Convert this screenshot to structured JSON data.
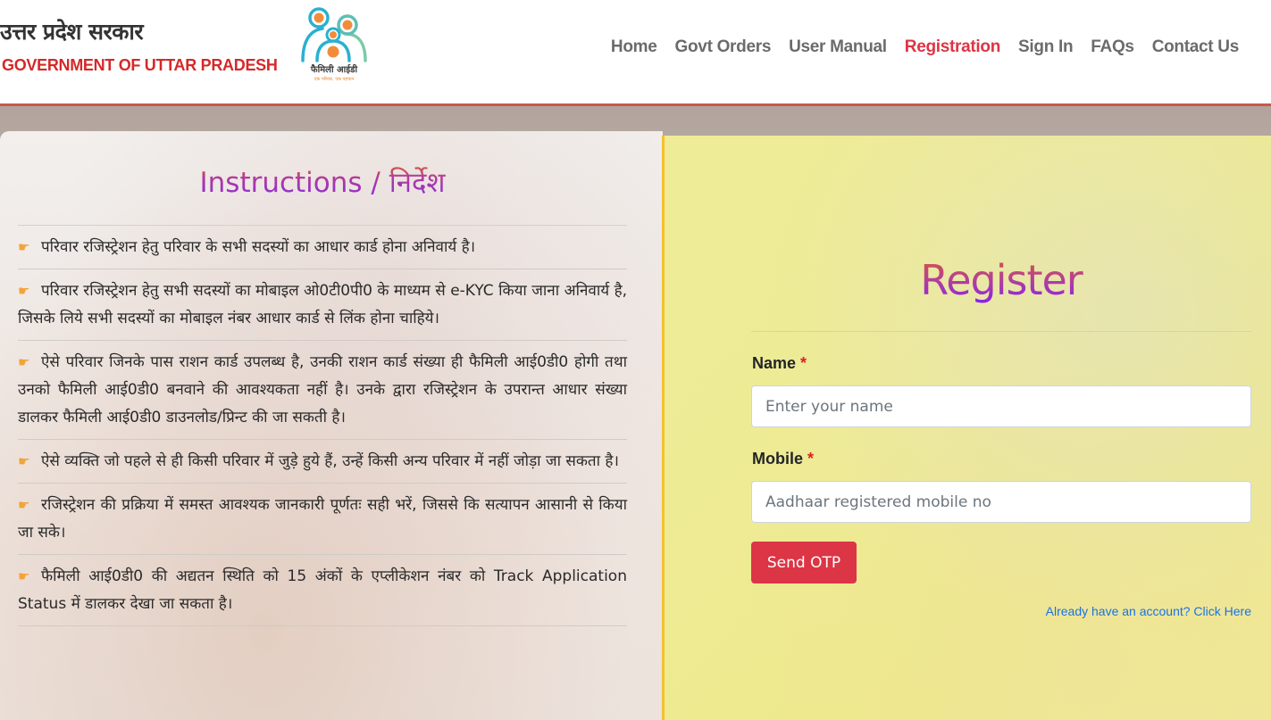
{
  "header": {
    "brand_hindi": "उत्तर प्रदेश सरकार",
    "brand_english": "GOVERNMENT OF UTTAR PRADESH",
    "logo_text": "फैमिली आईडी",
    "logo_tagline": "एक परिवार, एक पहचान",
    "nav": [
      {
        "label": "Home",
        "active": false
      },
      {
        "label": "Govt Orders",
        "active": false
      },
      {
        "label": "User Manual",
        "active": false
      },
      {
        "label": "Registration",
        "active": true
      },
      {
        "label": "Sign In",
        "active": false
      },
      {
        "label": "FAQs",
        "active": false
      },
      {
        "label": "Contact Us",
        "active": false
      }
    ]
  },
  "instructions": {
    "title": "Instructions / निर्देश",
    "bullet_icon": "hand-pointing-right-icon",
    "items": [
      "परिवार रजिस्ट्रेशन हेतु परिवार के सभी सदस्यों का आधार कार्ड होना अनिवार्य है।",
      "परिवार रजिस्ट्रेशन हेतु सभी सदस्यों का मोबाइल ओ0टी0पी0 के माध्यम से e-KYC किया जाना अनिवार्य है, जिसके लिये सभी सदस्यों का मोबाइल नंबर आधार कार्ड से लिंक होना चाहिये।",
      "ऐसे परिवार जिनके पास राशन कार्ड उपलब्ध है, उनकी राशन कार्ड संख्या ही फैमिली आई0डी0 होगी तथा उनको फैमिली आई0डी0 बनवाने की आवश्यकता नहीं है। उनके द्वारा रजिस्ट्रेशन के उपरान्त आधार संख्या डालकर फैमिली आई0डी0 डाउनलोड/प्रिन्ट की जा सकती है।",
      "ऐसे व्यक्ति जो पहले से ही किसी परिवार में जुड़े हुये हैं, उन्हें किसी अन्य परिवार में नहीं जोड़ा जा सकता है।",
      "रजिस्ट्रेशन की प्रक्रिया में समस्त आवश्यक जानकारी पूर्णतः सही भरें, जिससे कि सत्यापन आसानी से किया जा सके।",
      "फैमिली आई0डी0 की अद्यतन स्थिति को 15 अंकों के एप्लीकेशन नंबर को Track Application Status में डालकर देखा जा सकता है।"
    ]
  },
  "register": {
    "title": "Register",
    "name_label": "Name",
    "name_value": "",
    "name_placeholder": "Enter your name",
    "mobile_label": "Mobile",
    "mobile_value": "",
    "mobile_placeholder": "Aadhaar registered mobile no",
    "required_mark": "*",
    "send_otp_label": "Send OTP",
    "login_link_label": "Already have an account? Click Here"
  },
  "colors": {
    "accent_red": "#dc3545",
    "brand_red": "#d62828",
    "nav_gray": "#6b6b6b",
    "panel_yellow": "#eeeb94",
    "panel_border": "#f5c12e",
    "link_blue": "#1a73e8"
  }
}
